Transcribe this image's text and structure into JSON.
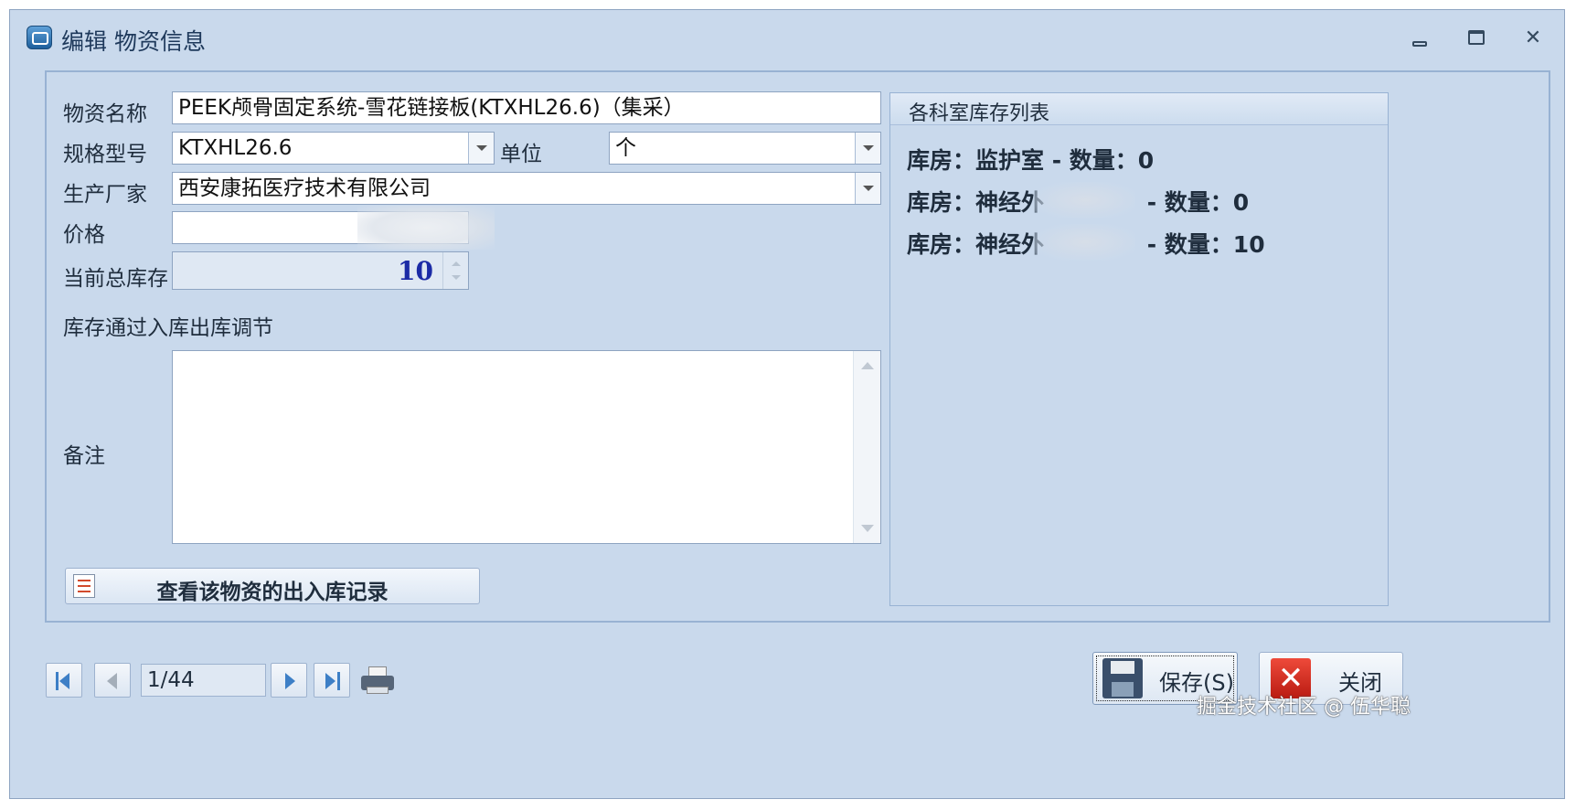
{
  "window": {
    "title": "编辑 物资信息",
    "controls": {
      "minimize": "",
      "maximize": "",
      "close": "✕"
    }
  },
  "form": {
    "name_label": "物资名称",
    "name_value": "PEEK颅骨固定系统-雪花链接板(KTXHL26.6)（集采）",
    "spec_label": "规格型号",
    "spec_value": "KTXHL26.6",
    "unit_label": "单位",
    "unit_value": "个",
    "maker_label": "生产厂家",
    "maker_value": "西安康拓医疗技术有限公司",
    "price_label": "价格",
    "price_value": "",
    "stock_label": "当前总库存",
    "stock_value": "10",
    "stock_note": "库存通过入库出库调节",
    "remark_label": "备注",
    "remark_value": "",
    "records_button": "查看该物资的出入库记录"
  },
  "stock_panel": {
    "title": "各科室库存列表",
    "rows": [
      {
        "prefix": "库房：监护室",
        "suffix": " - 数量：0"
      },
      {
        "prefix": "库房：神经外",
        "suffix": " - 数量：0"
      },
      {
        "prefix": "库房：神经外",
        "suffix": " - 数量：10"
      }
    ]
  },
  "navigator": {
    "position": "1/44"
  },
  "footer": {
    "save_label": "保存(S)",
    "close_label": "关闭"
  },
  "watermark": "掘金技术社区 @ 伍华聪",
  "colors": {
    "window_bg": "#c9d9ec",
    "stock_value": "#1b2ba6",
    "nav_accent": "#3d7fc6",
    "close_red": "#d2281c"
  }
}
